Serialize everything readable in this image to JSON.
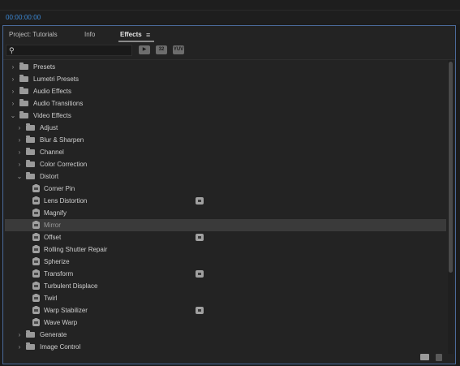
{
  "header": {
    "timecode": "00:00:00:00"
  },
  "tabs": [
    {
      "label": "Project: Tutorials"
    },
    {
      "label": "Info"
    },
    {
      "label": "Effects"
    }
  ],
  "toolbar": {
    "search_value": "",
    "filter_buttons": [
      "32",
      "YUV"
    ]
  },
  "tree": [
    {
      "label": "Presets",
      "level": 0,
      "type": "folder",
      "expanded": false
    },
    {
      "label": "Lumetri Presets",
      "level": 0,
      "type": "folder",
      "expanded": false
    },
    {
      "label": "Audio Effects",
      "level": 0,
      "type": "folder",
      "expanded": false
    },
    {
      "label": "Audio Transitions",
      "level": 0,
      "type": "folder",
      "expanded": false
    },
    {
      "label": "Video Effects",
      "level": 0,
      "type": "folder",
      "expanded": true
    },
    {
      "label": "Adjust",
      "level": 1,
      "type": "folder",
      "expanded": false
    },
    {
      "label": "Blur & Sharpen",
      "level": 1,
      "type": "folder",
      "expanded": false
    },
    {
      "label": "Channel",
      "level": 1,
      "type": "folder",
      "expanded": false
    },
    {
      "label": "Color Correction",
      "level": 1,
      "type": "folder",
      "expanded": false
    },
    {
      "label": "Distort",
      "level": 1,
      "type": "folder",
      "expanded": true
    },
    {
      "label": "Corner Pin",
      "level": 2,
      "type": "effect"
    },
    {
      "label": "Lens Distortion",
      "level": 2,
      "type": "effect",
      "badge": true
    },
    {
      "label": "Magnify",
      "level": 2,
      "type": "effect"
    },
    {
      "label": "Mirror",
      "level": 2,
      "type": "effect",
      "selected": true
    },
    {
      "label": "Offset",
      "level": 2,
      "type": "effect",
      "badge": true
    },
    {
      "label": "Rolling Shutter Repair",
      "level": 2,
      "type": "effect"
    },
    {
      "label": "Spherize",
      "level": 2,
      "type": "effect"
    },
    {
      "label": "Transform",
      "level": 2,
      "type": "effect",
      "badge": true
    },
    {
      "label": "Turbulent Displace",
      "level": 2,
      "type": "effect"
    },
    {
      "label": "Twirl",
      "level": 2,
      "type": "effect"
    },
    {
      "label": "Warp Stabilizer",
      "level": 2,
      "type": "effect",
      "badge": true
    },
    {
      "label": "Wave Warp",
      "level": 2,
      "type": "effect"
    },
    {
      "label": "Generate",
      "level": 1,
      "type": "folder",
      "expanded": false
    },
    {
      "label": "Image Control",
      "level": 1,
      "type": "folder",
      "expanded": false
    }
  ]
}
